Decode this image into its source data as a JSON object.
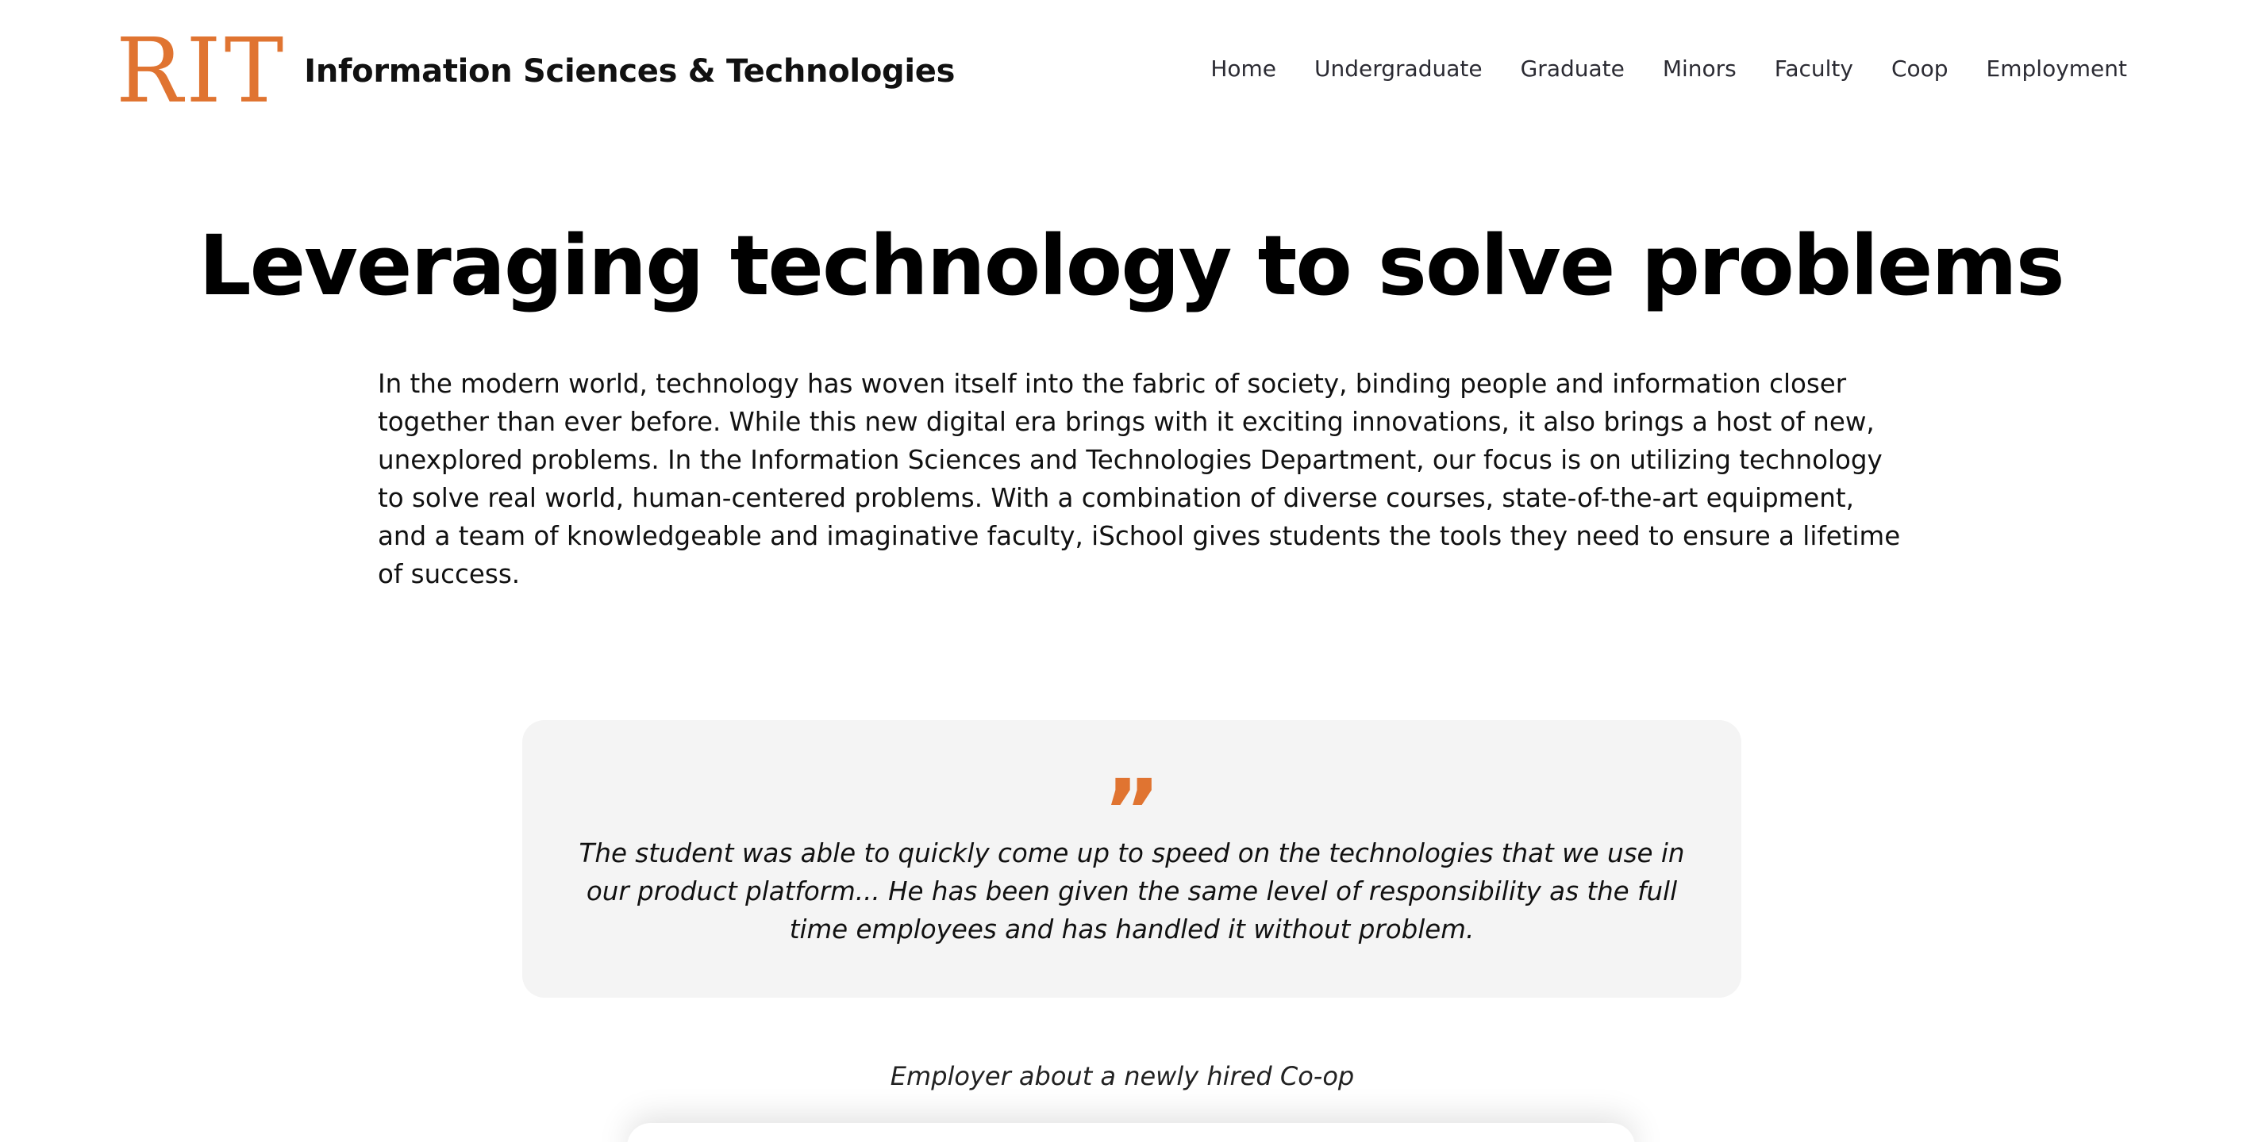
{
  "header": {
    "logo": "RIT",
    "site_title": "Information Sciences & Technologies",
    "brand_color": "#e07431",
    "nav": [
      {
        "label": "Home"
      },
      {
        "label": "Undergraduate"
      },
      {
        "label": "Graduate"
      },
      {
        "label": "Minors"
      },
      {
        "label": "Faculty"
      },
      {
        "label": "Coop"
      },
      {
        "label": "Employment"
      }
    ]
  },
  "hero": {
    "title": "Leveraging technology to solve problems",
    "intro": "In the modern world, technology has woven itself into the fabric of society, binding people and information closer together than ever before. While this new digital era brings with it exciting innovations, it also brings a host of new, unexplored problems. In the Information Sciences and Technologies Department, our focus is on utilizing technology to solve real world, human-centered problems. With a combination of diverse courses, state-of-the-art equipment, and a team of knowledgeable and imaginative faculty, iSchool gives students the tools they need to ensure a lifetime of success."
  },
  "testimonial": {
    "icon": "quote-icon",
    "quote": "The student was able to quickly come up to speed on the technologies that we use in our product platform... He has been given the same level of responsibility as the full time employees and has handled it without problem.",
    "attribution": "Employer about a newly hired Co-op",
    "card_color": "#f4f4f4"
  }
}
